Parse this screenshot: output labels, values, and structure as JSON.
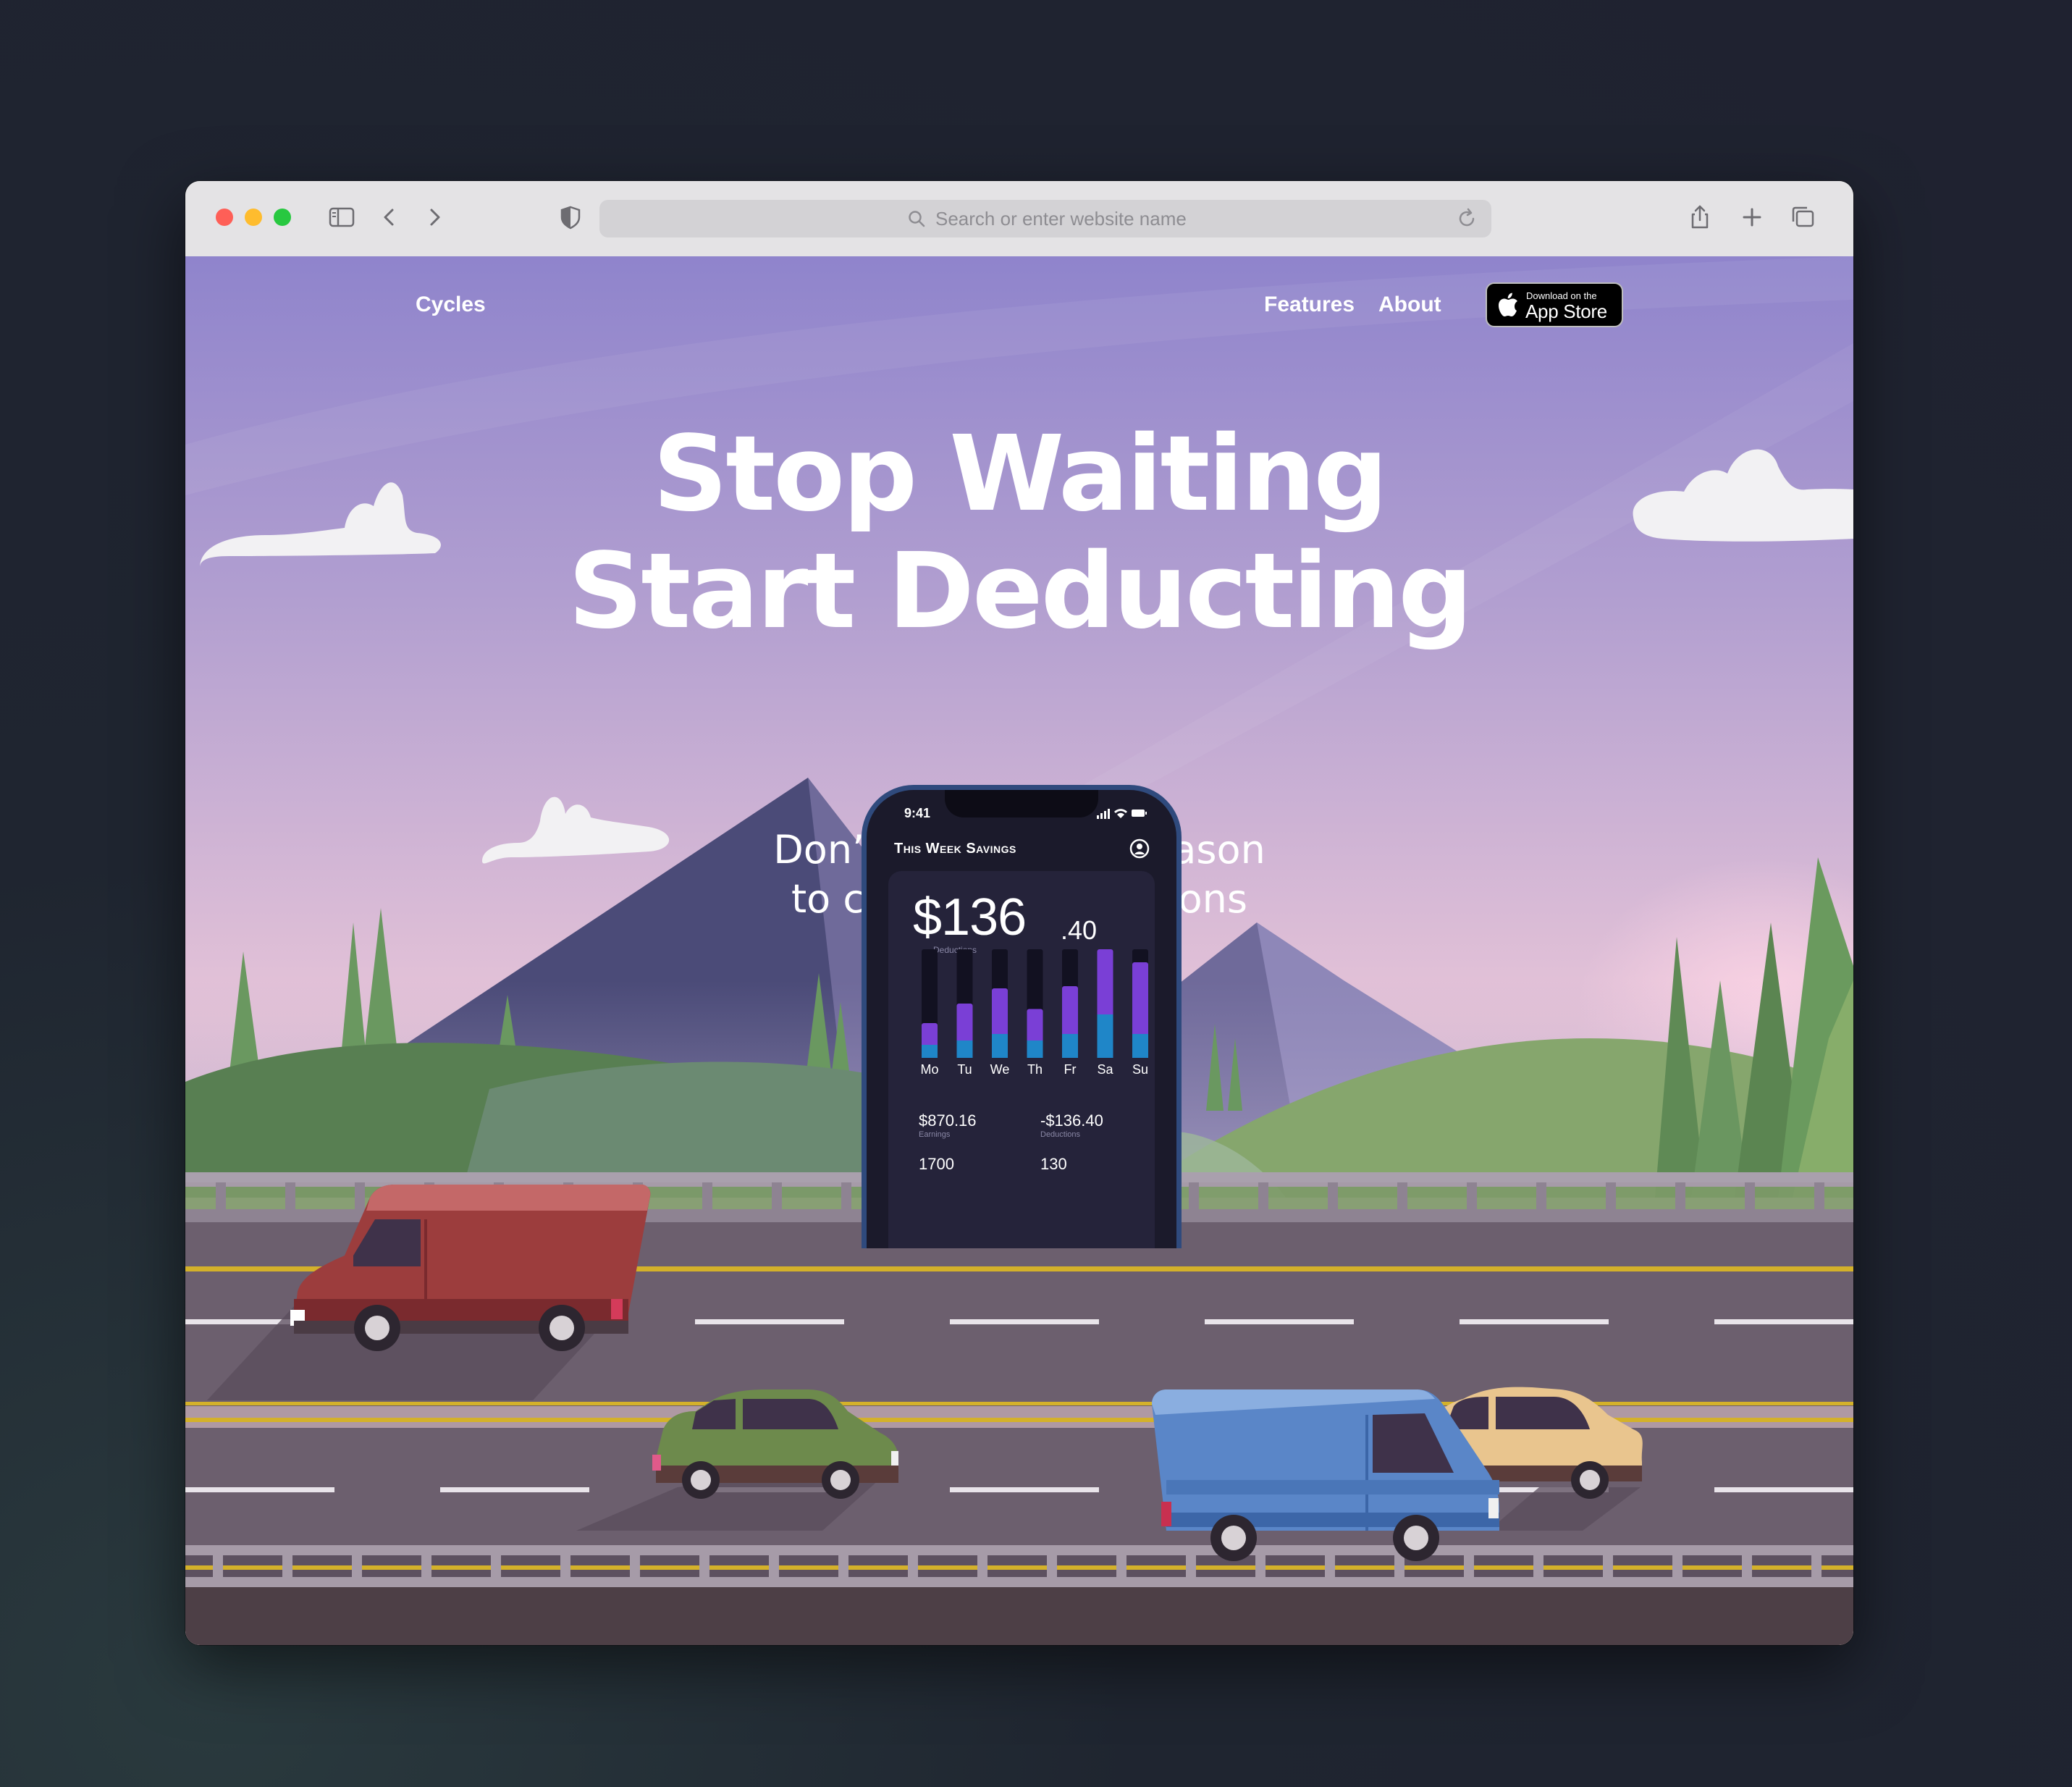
{
  "browser": {
    "address_placeholder": "Search or enter website name"
  },
  "nav": {
    "logo": "Cycles",
    "links": [
      "Features",
      "About"
    ],
    "app_store": {
      "small": "Download on the",
      "big": "App Store"
    }
  },
  "hero": {
    "headline_line1": "Stop Waiting",
    "headline_line2": "Start Deducting",
    "subhead_line1": "Don’t wait for tax season",
    "subhead_line2": "to calculate deductions"
  },
  "phone": {
    "time": "9:41",
    "card_title": "This Week Savings",
    "amount_main": "$136",
    "amount_cents": ".40",
    "amount_label": "Deductions",
    "days": [
      "Mo",
      "Tu",
      "We",
      "Th",
      "Fr",
      "Sa",
      "Su"
    ],
    "bar_levels": {
      "purple": [
        0.32,
        0.5,
        0.64,
        0.45,
        0.66,
        1.0,
        0.88
      ],
      "blue": [
        0.12,
        0.16,
        0.22,
        0.16,
        0.22,
        0.4,
        0.22
      ]
    },
    "earnings_value": "$870.16",
    "earnings_label": "Earnings",
    "deductions_value": "-$136.40",
    "deductions_label": "Deductions",
    "row2_left": "1700",
    "row2_right": "130"
  },
  "colors": {
    "sky_top": "#8f84cc",
    "sky_bottom": "#f0d1d8",
    "bar_purple": "#7a3fd6",
    "bar_blue": "#1f86c8",
    "road": "#6e6070"
  }
}
